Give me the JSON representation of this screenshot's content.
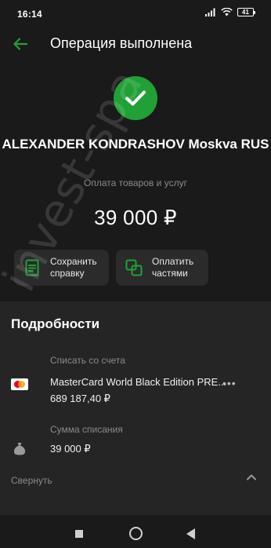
{
  "status_bar": {
    "time": "16:14",
    "battery": "41"
  },
  "header": {
    "title": "Операция выполнена"
  },
  "operation": {
    "recipient": "ALEXANDER KONDRASHOV Moskva RUS",
    "category": "Оплата товаров и услуг",
    "amount": "39 000 ₽"
  },
  "actions": {
    "save_label_line1": "Сохранить",
    "save_label_line2": "справку",
    "pay_label_line1": "Оплатить",
    "pay_label_line2": "частями"
  },
  "details": {
    "heading": "Подробности",
    "account_label": "Списать со счета",
    "card_name": "MasterCard World Black Edition PRE...",
    "card_balance": "689 187,40 ₽",
    "sum_label": "Сумма списания",
    "sum_value": "39 000 ₽",
    "collapse_label": "Свернуть"
  },
  "watermark": "invest-spa",
  "colors": {
    "accent": "#21a038",
    "background": "#1a1a1a",
    "panel": "#252525",
    "button_bg": "#2b2b2b",
    "muted_text": "#8a8a8a"
  },
  "icons": {
    "back": "arrow-left-icon",
    "success": "check-circle-icon",
    "save": "document-icon",
    "pay": "installments-icon",
    "card": "mastercard-icon",
    "sum": "money-bag-icon",
    "collapse": "chevron-up-icon"
  }
}
